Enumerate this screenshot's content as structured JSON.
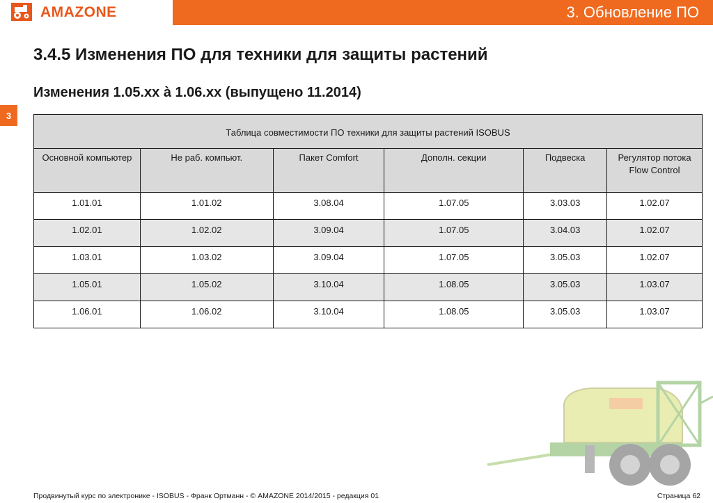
{
  "header": {
    "logo_text": "AMAZONE",
    "section_label": "3.  Обновление ПО",
    "brand_color": "#ef6a1f"
  },
  "chapter_tab": "3",
  "title": "3.4.5 Изменения ПО для техники для защиты растений",
  "subtitle": "Изменения 1.05.xx à 1.06.xx (выпущено 11.2014)",
  "table": {
    "caption": "Таблица совместимости ПО техники для защиты растений ISOBUS",
    "columns": [
      "Основной компьютер",
      "Не раб. компьют.",
      "Пакет Comfort",
      "Дополн. секции",
      "Подвеска",
      "Регулятор потока Flow Control"
    ],
    "rows": [
      [
        "1.01.01",
        "1.01.02",
        "3.08.04",
        "1.07.05",
        "3.03.03",
        "1.02.07"
      ],
      [
        "1.02.01",
        "1.02.02",
        "3.09.04",
        "1.07.05",
        "3.04.03",
        "1.02.07"
      ],
      [
        "1.03.01",
        "1.03.02",
        "3.09.04",
        "1.07.05",
        "3.05.03",
        "1.02.07"
      ],
      [
        "1.05.01",
        "1.05.02",
        "3.10.04",
        "1.08.05",
        "3.05.03",
        "1.03.07"
      ],
      [
        "1.06.01",
        "1.06.02",
        "3.10.04",
        "1.08.05",
        "3.05.03",
        "1.03.07"
      ]
    ]
  },
  "footer": {
    "left": "Продвинутый курс по электронике - ISOBUS - Франк Ортманн - © AMAZONE 2014/2015 - редакция 01",
    "right": "Страница 62"
  },
  "icons": {
    "logo": "amazone-tractor-logo-icon",
    "illustration": "field-sprayer-illustration"
  }
}
